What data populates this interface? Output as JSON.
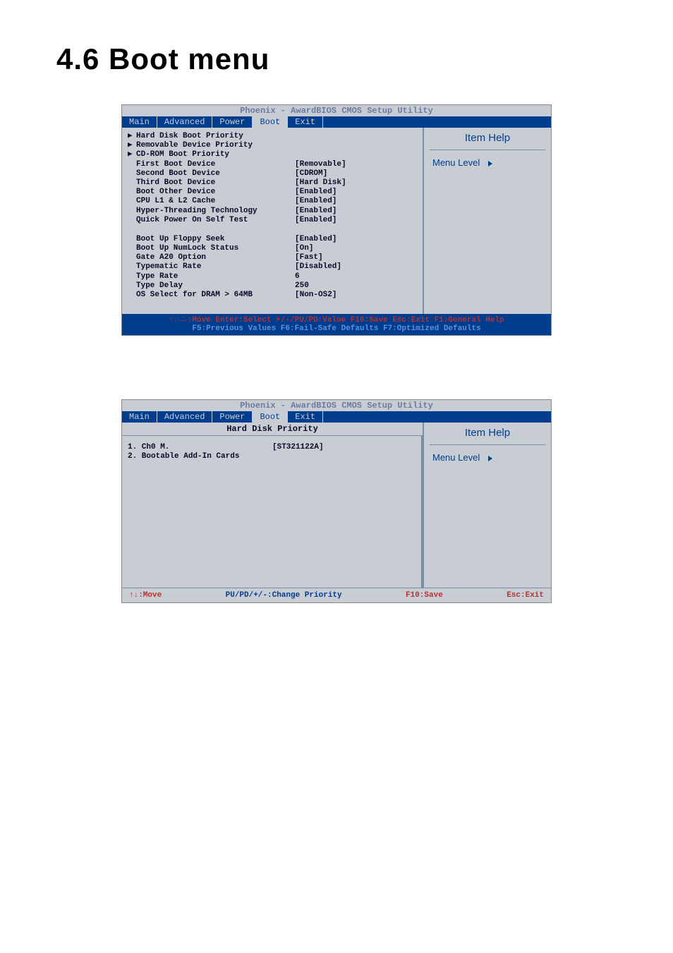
{
  "title": "4.6    Boot menu",
  "bios_title": "Phoenix - AwardBIOS CMOS Setup Utility",
  "tabs": [
    "Main",
    "Advanced",
    "Power",
    "Boot",
    "Exit"
  ],
  "help": {
    "title": "Item Help",
    "menu_level": "Menu Level"
  },
  "boot_menu": [
    {
      "arrow": "▶",
      "label": "Hard Disk Boot Priority",
      "value": ""
    },
    {
      "arrow": "▶",
      "label": "Removable Device Priority",
      "value": ""
    },
    {
      "arrow": "▶",
      "label": "CD-ROM Boot Priority",
      "value": ""
    },
    {
      "arrow": "",
      "label": " First Boot Device",
      "value": "[Removable]"
    },
    {
      "arrow": "",
      "label": " Second Boot Device",
      "value": "[CDROM]"
    },
    {
      "arrow": "",
      "label": " Third Boot Device",
      "value": "[Hard Disk]"
    },
    {
      "arrow": "",
      "label": " Boot Other Device",
      "value": "[Enabled]"
    },
    {
      "arrow": "",
      "label": " CPU L1 & L2 Cache",
      "value": "[Enabled]"
    },
    {
      "arrow": "",
      "label": " Hyper-Threading Technology",
      "value": "[Enabled]"
    },
    {
      "arrow": "",
      "label": " Quick Power On Self Test",
      "value": "[Enabled]"
    }
  ],
  "boot_menu2": [
    {
      "arrow": "",
      "label": " Boot Up Floppy Seek",
      "value": "[Enabled]"
    },
    {
      "arrow": "",
      "label": " Boot Up NumLock Status",
      "value": "[On]"
    },
    {
      "arrow": "",
      "label": " Gate A20 Option",
      "value": "[Fast]"
    },
    {
      "arrow": "",
      "label": " Typematic Rate",
      "value": "[Disabled]"
    },
    {
      "arrow": "",
      "label": " Type Rate",
      "value": "6"
    },
    {
      "arrow": "",
      "label": " Type Delay",
      "value": "250"
    },
    {
      "arrow": "",
      "label": " OS Select for DRAM > 64MB",
      "value": "[Non-OS2]"
    }
  ],
  "footer1": "↑↓→←:Move  Enter:Select  +/-/PU/PD:Value  F10:Save  Esc:Exit  F1:General Help",
  "footer2": "F5:Previous Values  F6:Fail-Safe Defaults F7:Optimized Defaults",
  "hdd": {
    "title": "Hard Disk Priority",
    "items": [
      {
        "label": "1. Ch0 M.",
        "value": "[ST321122A]"
      },
      {
        "label": "2. Bootable Add-In Cards",
        "value": ""
      }
    ]
  },
  "footer_simple": {
    "move": "↑↓:Move",
    "change": "PU/PD/+/-:Change Priority",
    "save": "F10:Save",
    "exit": "Esc:Exit"
  }
}
